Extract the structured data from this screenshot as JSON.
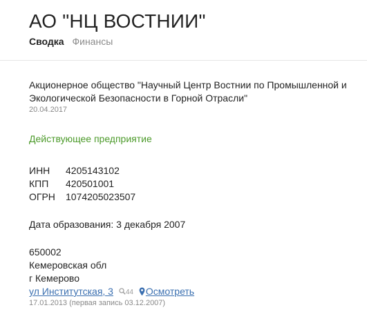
{
  "header": {
    "title": "АО \"НЦ ВОСТНИИ\""
  },
  "tabs": [
    {
      "label": "Сводка",
      "active": true
    },
    {
      "label": "Финансы",
      "active": false
    }
  ],
  "company": {
    "full_name": "Акционерное общество \"Научный Центр Востнии по Промышленной и Экологической Безопасности в Горной Отрасли\"",
    "reg_date": "20.04.2017",
    "status": "Действующее предприятие",
    "status_color": "#4c9a2a",
    "codes": [
      {
        "label": "ИНН",
        "value": "4205143102"
      },
      {
        "label": "КПП",
        "value": "420501001"
      },
      {
        "label": "ОГРН",
        "value": "1074205023507"
      }
    ],
    "founded_text": "Дата образования: 3 декабря 2007",
    "address": {
      "postcode": "650002",
      "region": "Кемеровская обл",
      "city": "г Кемерово",
      "street": "ул Институтская, 3",
      "search_count": "44",
      "view_label": "Осмотреть",
      "date_note": "17.01.2013 (первая запись 03.12.2007)"
    }
  },
  "colors": {
    "link": "#3a6fb0",
    "muted": "#888888"
  }
}
